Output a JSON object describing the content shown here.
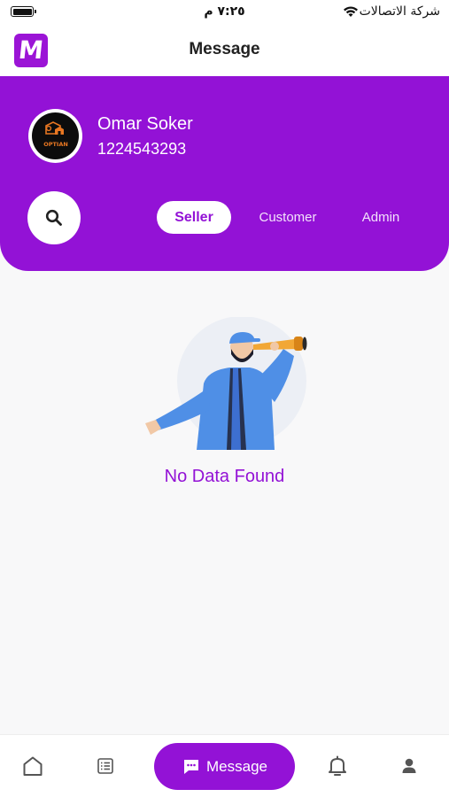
{
  "status_bar": {
    "time": "٧:٢٥ م",
    "carrier": "شركة الاتصالات"
  },
  "header": {
    "logo_letter": "M",
    "title": "Message"
  },
  "profile": {
    "name": "Omar Soker",
    "phone": "1224543293",
    "avatar_logo_text": "OPTIAN"
  },
  "tabs": [
    {
      "label": "Seller",
      "active": true
    },
    {
      "label": "Customer",
      "active": false
    },
    {
      "label": "Admin",
      "active": false
    }
  ],
  "empty_state": {
    "message": "No Data Found"
  },
  "bottom_nav": {
    "items": [
      {
        "icon": "home-icon"
      },
      {
        "icon": "list-icon"
      },
      {
        "icon": "message-icon",
        "label": "Message",
        "active": true
      },
      {
        "icon": "bell-icon"
      },
      {
        "icon": "user-icon"
      }
    ]
  },
  "colors": {
    "brand_purple": "#9312d6",
    "background": "#f8f8f9",
    "white": "#ffffff"
  }
}
